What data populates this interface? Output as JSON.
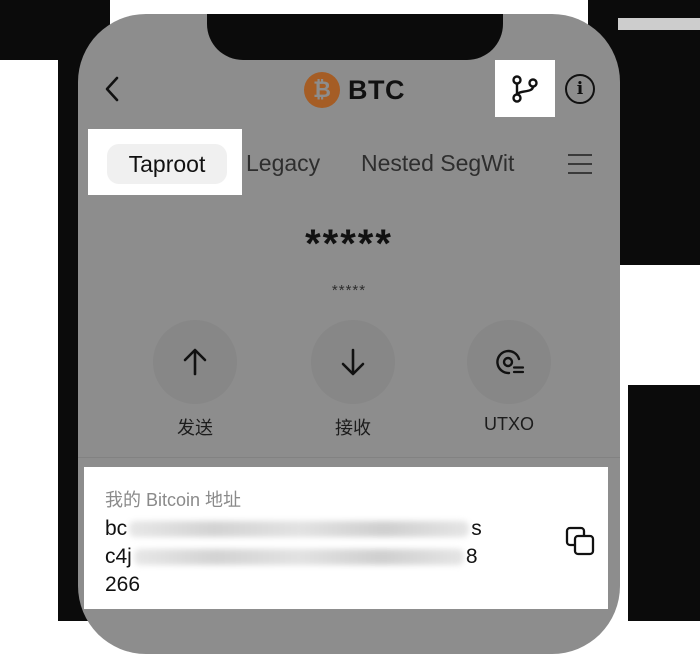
{
  "header": {
    "title": "BTC",
    "coin_symbol": "₿",
    "back_icon": "chevron-left-icon",
    "branch_icon": "branch-icon",
    "info_icon": "info-icon",
    "info_glyph": "i"
  },
  "tabs": [
    {
      "label": "Taproot",
      "selected": true
    },
    {
      "label": "Legacy",
      "selected": false
    },
    {
      "label": "Nested SegWit",
      "selected": false
    }
  ],
  "balance": {
    "main": "*****",
    "secondary": "*****"
  },
  "actions": [
    {
      "label": "发送",
      "icon": "arrow-up-icon"
    },
    {
      "label": "接收",
      "icon": "arrow-down-icon"
    },
    {
      "label": "UTXO",
      "icon": "utxo-icon"
    }
  ],
  "address": {
    "heading": "我的 Bitcoin 地址",
    "line1_start": "bc",
    "line1_end": "s",
    "line2_start": "c4j",
    "line2_end": "8",
    "line3_start": "26",
    "line3_end": "6"
  },
  "colors": {
    "overlay_grey": "#8d8d8d",
    "highlight": "#ffffff",
    "btc_orange": "#a55d25",
    "text_dark": "#111111"
  }
}
